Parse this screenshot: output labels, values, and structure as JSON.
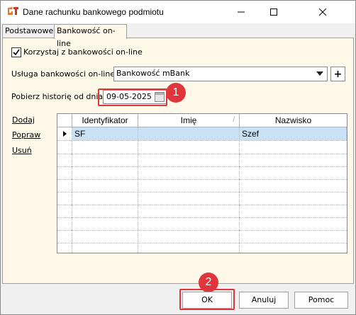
{
  "window": {
    "title": "Dane rachunku bankowego podmiotu",
    "icon": "gt-app-icon",
    "controls": [
      "minimize-icon",
      "maximize-icon",
      "close-icon"
    ]
  },
  "tabs": [
    {
      "label": "Podstawowe",
      "active": false
    },
    {
      "label": "Bankowość on-line",
      "active": true
    }
  ],
  "online_banking": {
    "checkbox_label": "Korzystaj z bankowości on-line",
    "checked": true,
    "service_label": "Usługa bankowości on-line:",
    "service_value": "Bankowość mBank",
    "add_button": "+",
    "history_label": "Pobierz historię od dnia:",
    "history_date": "09-05-2025"
  },
  "side_actions": [
    "Dodaj",
    "Popraw",
    "Usuń"
  ],
  "grid": {
    "columns": [
      "Identyfikator",
      "Imię",
      "Nazwisko"
    ],
    "rows": [
      {
        "identyfikator": "SF",
        "imie": "",
        "nazwisko": "Szef",
        "selected": true
      }
    ],
    "sort_column_marker": "/"
  },
  "buttons": {
    "ok": "OK",
    "cancel": "Anuluj",
    "help": "Pomoc"
  },
  "annotations": {
    "badge_1": "1",
    "badge_2": "2",
    "color": "#e0363b"
  },
  "colors": {
    "tab_body": "#fdf8e8",
    "selection": "#c8e1f5"
  }
}
